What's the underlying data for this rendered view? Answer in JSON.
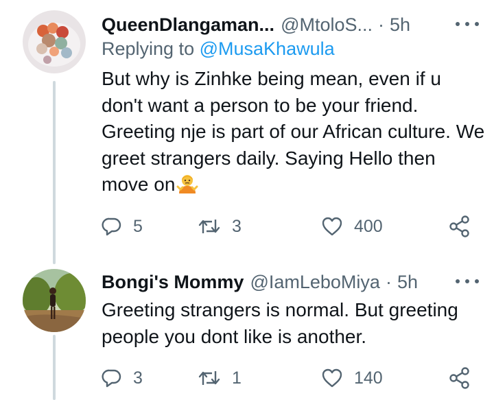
{
  "tweets": [
    {
      "display_name": "QueenDlangaman...",
      "handle": "@MtoloS...",
      "separator": "·",
      "time": "5h",
      "replying_prefix": "Replying to",
      "replying_to": "@MusaKhawula",
      "text": "But why is Zinhke being mean, even if u don't want a person to be your friend. Greeting nje is part of our African culture. We greet strangers daily. Saying Hello then move on",
      "emoji": "person-shrugging-emoji",
      "replies": "5",
      "retweets": "3",
      "likes": "400"
    },
    {
      "display_name": "Bongi's Mommy",
      "handle": "@IamLeboMiya",
      "separator": "·",
      "time": "5h",
      "text": "Greeting strangers is normal. But greeting people you dont like is another.",
      "replies": "3",
      "retweets": "1",
      "likes": "140"
    }
  ],
  "colors": {
    "text": "#0f1419",
    "secondary": "#536471",
    "link": "#1d9bf0",
    "thread_line": "#cfd9de"
  }
}
